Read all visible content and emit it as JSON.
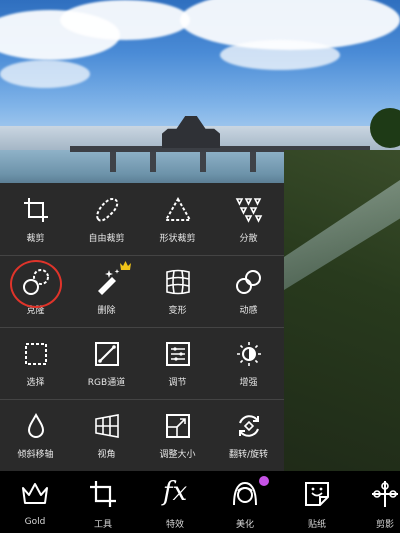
{
  "tools": [
    {
      "label": "裁剪",
      "icon": "crop-icon"
    },
    {
      "label": "自由裁剪",
      "icon": "freeform-crop-icon"
    },
    {
      "label": "形状裁剪",
      "icon": "shape-crop-icon"
    },
    {
      "label": "分散",
      "icon": "disperse-icon"
    },
    {
      "label": "克隆",
      "icon": "clone-icon"
    },
    {
      "label": "删除",
      "icon": "remove-icon"
    },
    {
      "label": "变形",
      "icon": "warp-icon"
    },
    {
      "label": "动感",
      "icon": "motion-icon"
    },
    {
      "label": "选择",
      "icon": "select-icon"
    },
    {
      "label": "RGB通道",
      "icon": "rgb-channel-icon"
    },
    {
      "label": "调节",
      "icon": "adjust-icon"
    },
    {
      "label": "增强",
      "icon": "enhance-icon"
    },
    {
      "label": "倾斜移轴",
      "icon": "tilt-shift-icon"
    },
    {
      "label": "视角",
      "icon": "perspective-icon"
    },
    {
      "label": "调整大小",
      "icon": "resize-icon"
    },
    {
      "label": "翻转/旋转",
      "icon": "flip-rotate-icon"
    }
  ],
  "bottom_tabs": [
    {
      "label": "Gold",
      "icon": "crown-icon"
    },
    {
      "label": "工具",
      "icon": "crop-tool-icon"
    },
    {
      "label": "特效",
      "icon": "fx-icon",
      "glyph": "fx"
    },
    {
      "label": "美化",
      "icon": "beautify-face-icon"
    },
    {
      "label": "贴纸",
      "icon": "sticker-icon"
    },
    {
      "label": "剪影",
      "icon": "cutout-icon"
    }
  ],
  "colors": {
    "panel_bg": "#2a2a2a",
    "highlight_ring": "#e0342a",
    "premium_badge": "#f0c419",
    "notification_dot": "#c653e6"
  }
}
